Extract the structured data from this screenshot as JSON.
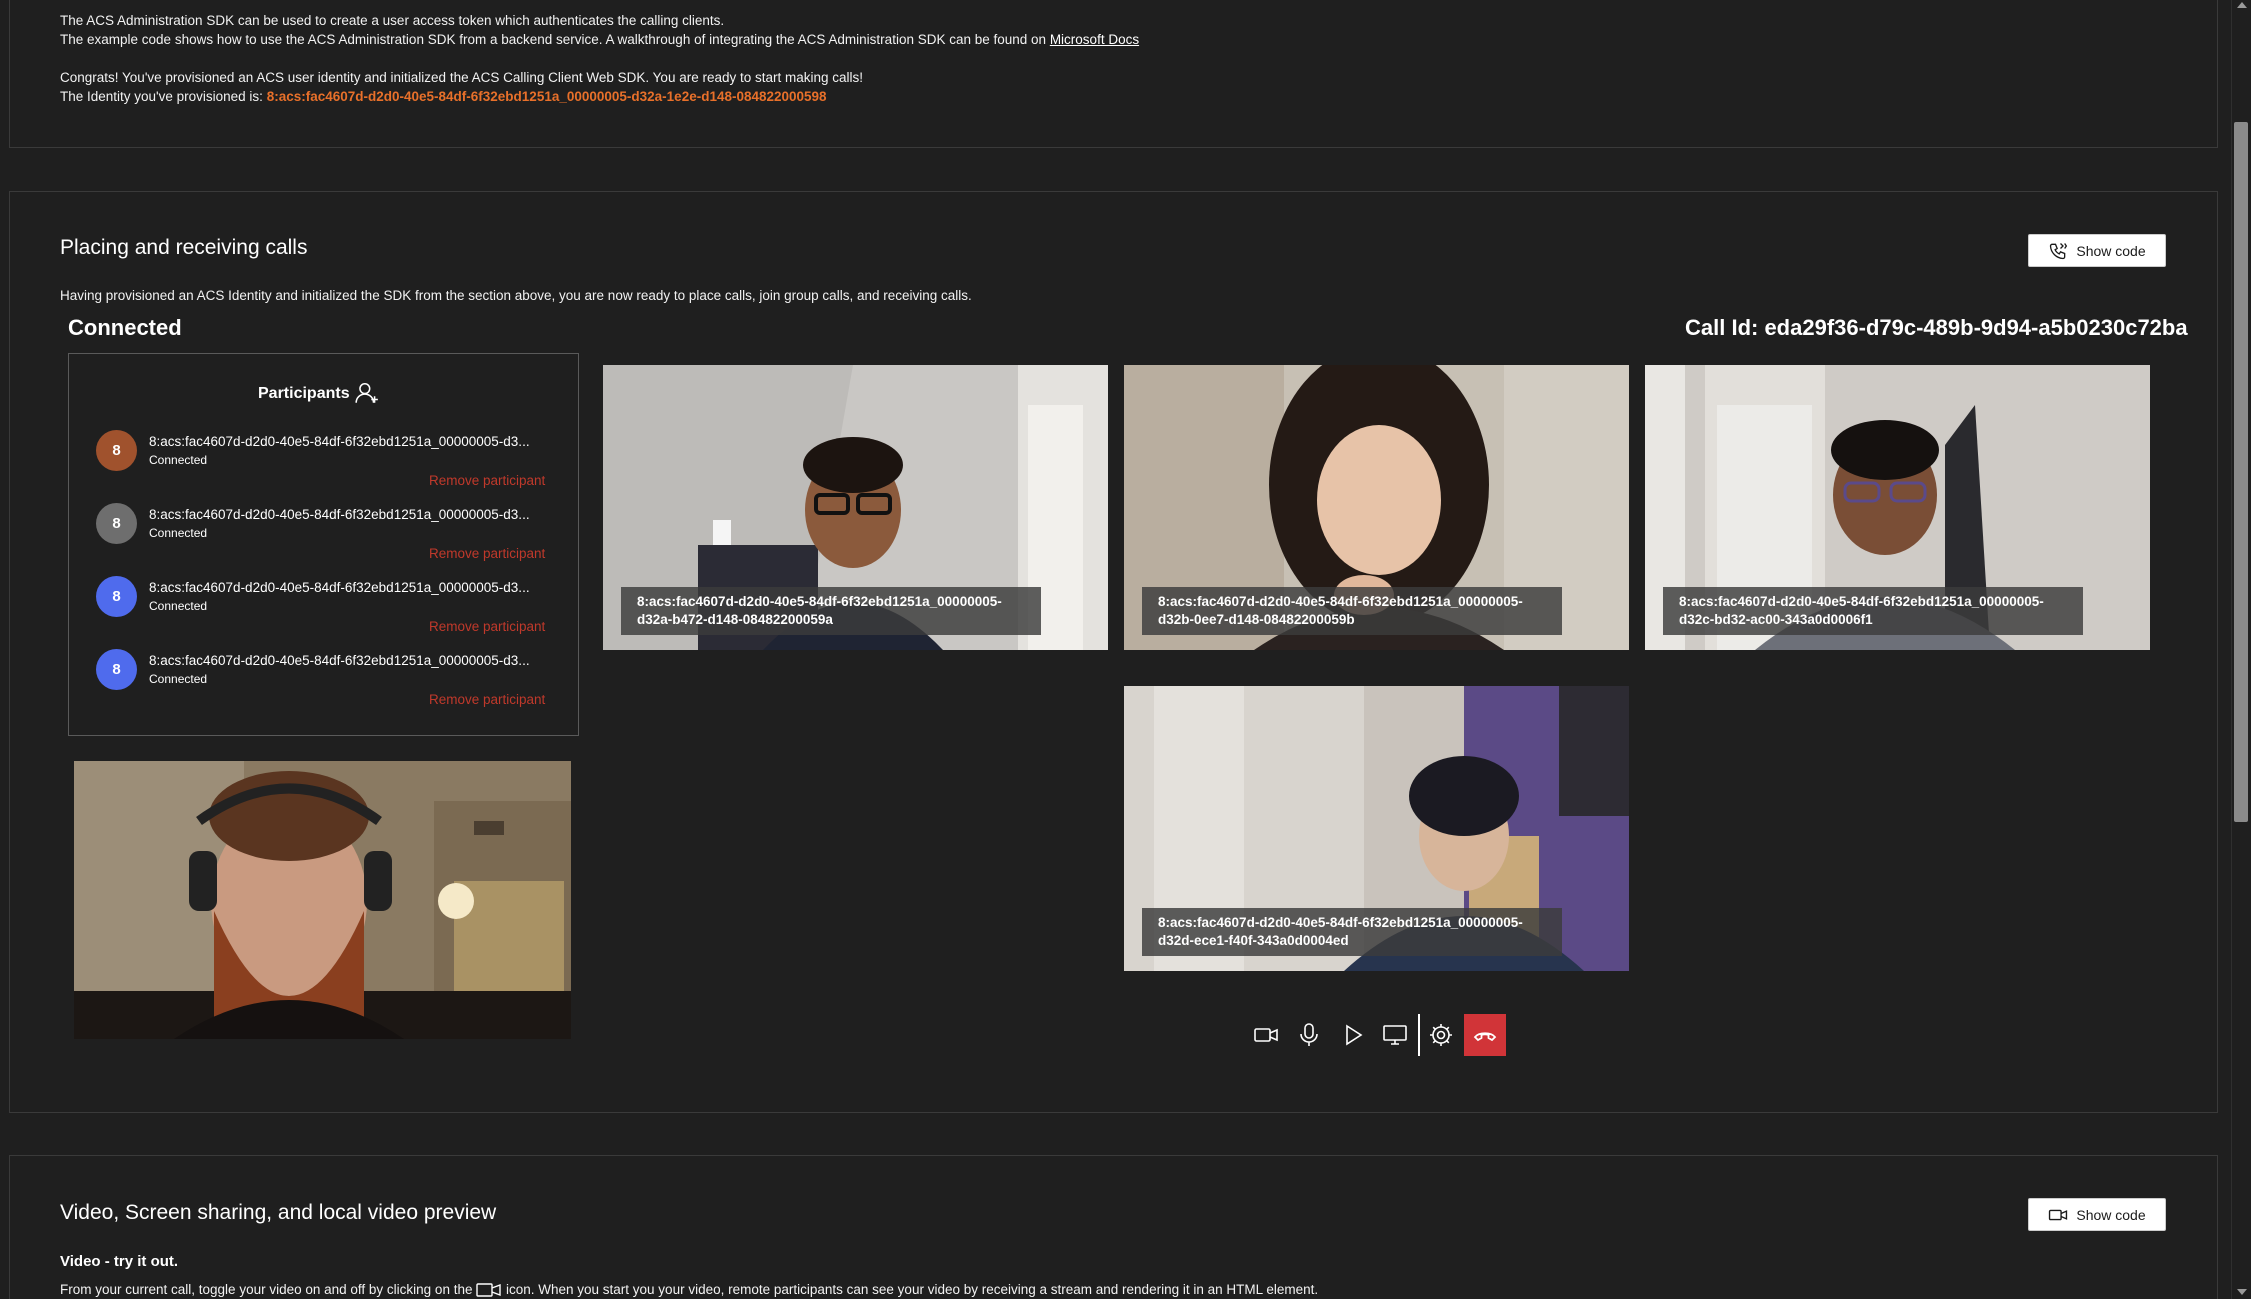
{
  "top_section": {
    "line1": "The ACS Administration SDK can be used to create a user access token which authenticates the calling clients.",
    "line2_prefix": "The example code shows how to use the ACS Administration SDK from a backend service. A walkthrough of integrating the ACS Administration SDK can be found on ",
    "line2_link": "Microsoft Docs",
    "line3": "Congrats! You've provisioned an ACS user identity and initialized the ACS Calling Client Web SDK. You are ready to start making calls!",
    "line4_prefix": "The Identity you've provisioned is: ",
    "identity": "8:acs:fac4607d-d2d0-40e5-84df-6f32ebd1251a_00000005-d32a-1e2e-d148-084822000598"
  },
  "calls_section": {
    "title": "Placing and receiving calls",
    "show_code_label": "Show code",
    "description": "Having provisioned an ACS Identity and initialized the SDK from the section above, you are now ready to place calls, join group calls, and receiving calls.",
    "call_state": "Connected",
    "call_id": "Call Id: eda29f36-d79c-489b-9d94-a5b0230c72ba",
    "participants_title": "Participants",
    "participants": [
      {
        "avatar": "8",
        "avatar_color": "#a0522d",
        "name": "8:acs:fac4607d-d2d0-40e5-84df-6f32ebd1251a_00000005-d3...",
        "status": "Connected",
        "remove_label": "Remove participant"
      },
      {
        "avatar": "8",
        "avatar_color": "#6e6e6e",
        "name": "8:acs:fac4607d-d2d0-40e5-84df-6f32ebd1251a_00000005-d3...",
        "status": "Connected",
        "remove_label": "Remove participant"
      },
      {
        "avatar": "8",
        "avatar_color": "#4f6bed",
        "name": "8:acs:fac4607d-d2d0-40e5-84df-6f32ebd1251a_00000005-d3...",
        "status": "Connected",
        "remove_label": "Remove participant"
      },
      {
        "avatar": "8",
        "avatar_color": "#4f6bed",
        "name": "8:acs:fac4607d-d2d0-40e5-84df-6f32ebd1251a_00000005-d3...",
        "status": "Connected",
        "remove_label": "Remove participant"
      }
    ],
    "remote_videos": [
      {
        "label": "8:acs:fac4607d-d2d0-40e5-84df-6f32ebd1251a_00000005-\nd32a-b472-d148-08482200059a"
      },
      {
        "label": "8:acs:fac4607d-d2d0-40e5-84df-6f32ebd1251a_00000005-\nd32b-0ee7-d148-08482200059b"
      },
      {
        "label": "8:acs:fac4607d-d2d0-40e5-84df-6f32ebd1251a_00000005-\nd32c-bd32-ac00-343a0d0006f1"
      },
      {
        "label": "8:acs:fac4607d-d2d0-40e5-84df-6f32ebd1251a_00000005-\nd32d-ece1-f40f-343a0d0004ed"
      }
    ],
    "controls": {
      "video_icon": "video-camera-icon",
      "mic_icon": "microphone-icon",
      "play_icon": "play-icon",
      "screen_icon": "screen-share-icon",
      "settings_icon": "gear-icon",
      "hangup_icon": "hang-up-icon",
      "hangup_color": "#d13438"
    }
  },
  "video_section": {
    "title": "Video, Screen sharing, and local video preview",
    "show_code_label": "Show code",
    "subheading": "Video - try it out.",
    "description_prefix": "From your current call, toggle your video on and off by clicking on the ",
    "description_suffix": " icon. When you start you your video, remote participants can see your video by receiving a stream and rendering it in an HTML element."
  }
}
